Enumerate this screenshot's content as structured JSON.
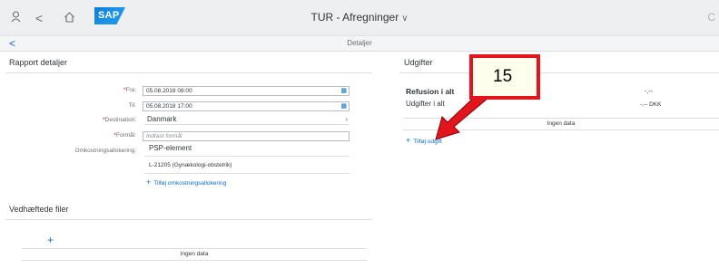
{
  "shell": {
    "title": "TUR - Afregninger",
    "title_chevron": "∨",
    "logo_text": "SAP",
    "right_icon": "C",
    "icons": [
      "user-icon",
      "back-icon",
      "home-icon"
    ]
  },
  "subheader": {
    "back": "<",
    "title": "Detaljer"
  },
  "report": {
    "title": "Rapport detaljer",
    "fields": [
      {
        "label": "Fra:",
        "required": true,
        "value": "05.08.2018 08:00"
      },
      {
        "label": "Til:",
        "required": false,
        "value": "05.08.2018 17:00"
      },
      {
        "label": "Destination:",
        "required": true,
        "value": "Danmark"
      },
      {
        "label": "Formål:",
        "required": true,
        "placeholder": "Indtast formål"
      },
      {
        "label": "Omkostningsallokering:",
        "required": false,
        "value": "PSP-element"
      }
    ],
    "psp_detail": "L-21205 (Gynækologi-obstetrik)",
    "add_allocation": "Tilføj omkostningsallokering",
    "req_star": "*"
  },
  "attachments": {
    "title": "Vedhæftede filer",
    "add_icon": "+",
    "no_data": "Ingen data"
  },
  "expenses": {
    "title": "Udgifter",
    "refund_label": "Refusion i alt",
    "refund_value": "-,--",
    "expenses_label": "Udgifter i alt",
    "expenses_value": "-,-- DKK",
    "no_data": "Ingen data",
    "add_expense": "Tilføj udgift"
  },
  "callout": {
    "number": "15",
    "colors": {
      "border": "#e3141b",
      "fill": "#fefeec",
      "arrow": "#e3141b"
    }
  },
  "colors": {
    "accent": "#0a6ed1",
    "required": "#ee0000",
    "shell_bg": "#edeff0"
  }
}
